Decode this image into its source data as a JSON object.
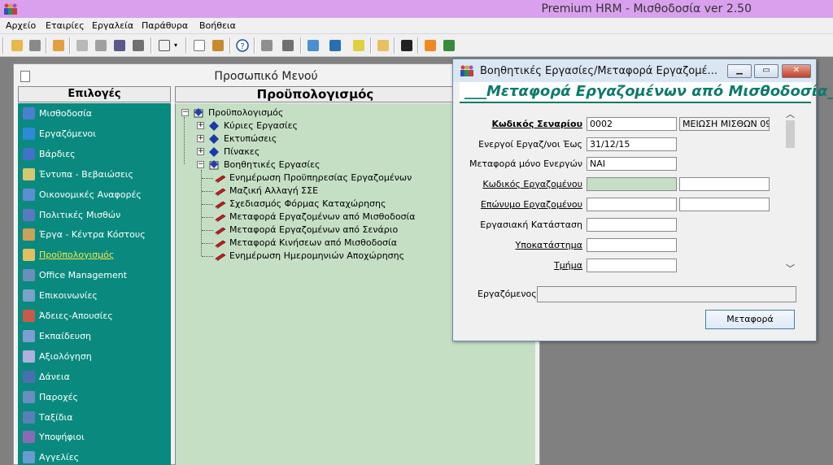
{
  "app": {
    "title": "Premium HRM - Μισθοδοσία ver 2.50"
  },
  "menu": [
    "Αρχείο",
    "Εταιρίες",
    "Εργαλεία",
    "Παράθυρα",
    "Βοήθεια"
  ],
  "toolbar_icons": [
    "open-folder-icon",
    "key-icon",
    "pencil-icon",
    "tools-icon",
    "print-icon",
    "calendar-icon",
    "notes-icon",
    "window-layout-icon",
    "document-icon",
    "books-icon",
    "help-icon",
    "copy-icon",
    "window-icon",
    "box-icon",
    "import-icon",
    "export-icon",
    "folder-icon",
    "terminal-icon",
    "rss-icon",
    "exit-icon"
  ],
  "main_window": {
    "title": "Προσωπικό Μενού",
    "options_header": "Επιλογές",
    "tree_header": "Προϋπολογισμός"
  },
  "sidebar": {
    "items": [
      {
        "label": "Μισθοδοσία",
        "color": "#4a7fd0"
      },
      {
        "label": "Εργαζόμενοι",
        "color": "#2d8ad6"
      },
      {
        "label": "Βάρδιες",
        "color": "#3f72c8"
      },
      {
        "label": "Έντυπα - Βεβαιώσεις",
        "color": "#d5c870"
      },
      {
        "label": "Οικονομικές Αναφορές",
        "color": "#5b8fd0"
      },
      {
        "label": "Πολιτικές Μισθών",
        "color": "#5a78c0"
      },
      {
        "label": "Έργα - Κέντρα Κόστους",
        "color": "#c9a35a"
      },
      {
        "label": "Προϋπολογισμός",
        "color": "#e0c060",
        "active": true
      },
      {
        "label": "Office Management",
        "color": "#6b8fb8"
      },
      {
        "label": "Επικοινωνίες",
        "color": "#7aa3c8"
      },
      {
        "label": "Άδειες-Απουσίες",
        "color": "#c85a4a"
      },
      {
        "label": "Εκπαίδευση",
        "color": "#7b9fd0"
      },
      {
        "label": "Αξιολόγηση",
        "color": "#b0b0e0"
      },
      {
        "label": "Δάνεια",
        "color": "#4a6fb0"
      },
      {
        "label": "Παροχές",
        "color": "#6a8ec0"
      },
      {
        "label": "Ταξίδια",
        "color": "#5a7fb8"
      },
      {
        "label": "Υποψήφιοι",
        "color": "#8a6ab8"
      },
      {
        "label": "Αγγελίες",
        "color": "#6a9ad0"
      }
    ]
  },
  "tree": {
    "root": "Προϋπολογισμός",
    "groups": [
      "Κύριες Εργασίες",
      "Εκτυπώσεις",
      "Πίνακες",
      "Βοηθητικές Εργασίες"
    ],
    "children": [
      "Ενημέρωση Προϋπηρεσίας Εργαζομένων",
      "Μαζική Αλλαγή ΣΣΕ",
      "Σχεδιασμός Φόρμας Καταχώρησης",
      "Μεταφορά Εργαζομένων από Μισθοδοσία",
      "Μεταφορά Εργαζομένων από Σενάριο",
      "Μεταφορά Κινήσεων από Μισθοδοσία",
      "Ενημέρωση Ημερομηνιών Αποχώρησης"
    ]
  },
  "dialog": {
    "title": "Βοηθητικές Εργασίες/Μεταφορά Εργαζομέ...",
    "band": "___Μεταφορά Εργαζομένων από Μισθοδοσία_",
    "fields": [
      {
        "label": "Κωδικός Σεναρίου",
        "value": "0002",
        "extra": "ΜΕΙΩΣΗ ΜΙΣΘΩΝ 09/2"
      },
      {
        "label": "Ενεργοί Εργαζ/νοι Έως",
        "value": "31/12/15"
      },
      {
        "label": "Μεταφορά μόνο Ενεργών",
        "value": "ΝΑΙ"
      },
      {
        "label": "Κωδικός Εργαζομένου",
        "value": "",
        "extra": ""
      },
      {
        "label": "Επώνυμο Εργαζομένου",
        "value": "",
        "extra": ""
      },
      {
        "label": "Εργασιακή Κατάσταση",
        "value": ""
      },
      {
        "label": "Υποκατάστημα",
        "value": ""
      },
      {
        "label": "Τμήμα",
        "value": ""
      }
    ],
    "employee_label": "Εργαζόμενος",
    "employee_value": "",
    "transfer_button": "Μεταφορά"
  }
}
